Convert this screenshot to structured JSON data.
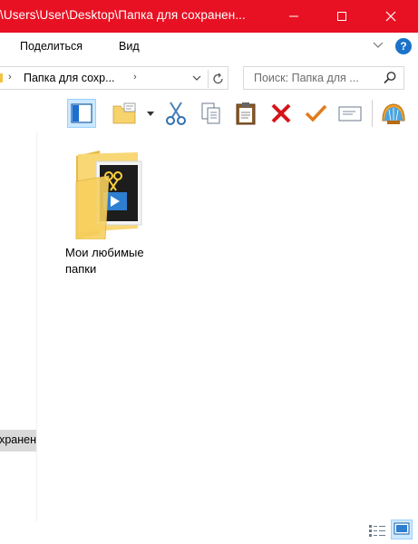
{
  "window": {
    "title": "\\Users\\User\\Desktop\\Папка для сохранен...",
    "accent_color": "#e81123",
    "controls": [
      "minimize-icon",
      "maximize-icon",
      "close-icon"
    ]
  },
  "ribbon": {
    "tabs": [
      {
        "label": "Поделиться"
      },
      {
        "label": "Вид"
      }
    ],
    "help_label": "?"
  },
  "address": {
    "path": "Папка для сохр...",
    "separator": "›"
  },
  "search": {
    "placeholder": "Поиск: Папка для ..."
  },
  "toolbar": {
    "buttons": [
      "layout-icon",
      "new-folder-icon",
      "cut-icon",
      "copy-icon",
      "paste-icon",
      "delete-icon",
      "check-icon",
      "mail-icon",
      "shell-icon"
    ]
  },
  "nav_pane": {
    "selected_item": "Папка для сохранен"
  },
  "content": {
    "items": [
      {
        "label_line1": "Мои любимые",
        "label_line2": "папки",
        "type": "folder"
      }
    ]
  },
  "statusbar": {
    "views": [
      "details-view-icon",
      "large-icons-view-icon"
    ]
  }
}
